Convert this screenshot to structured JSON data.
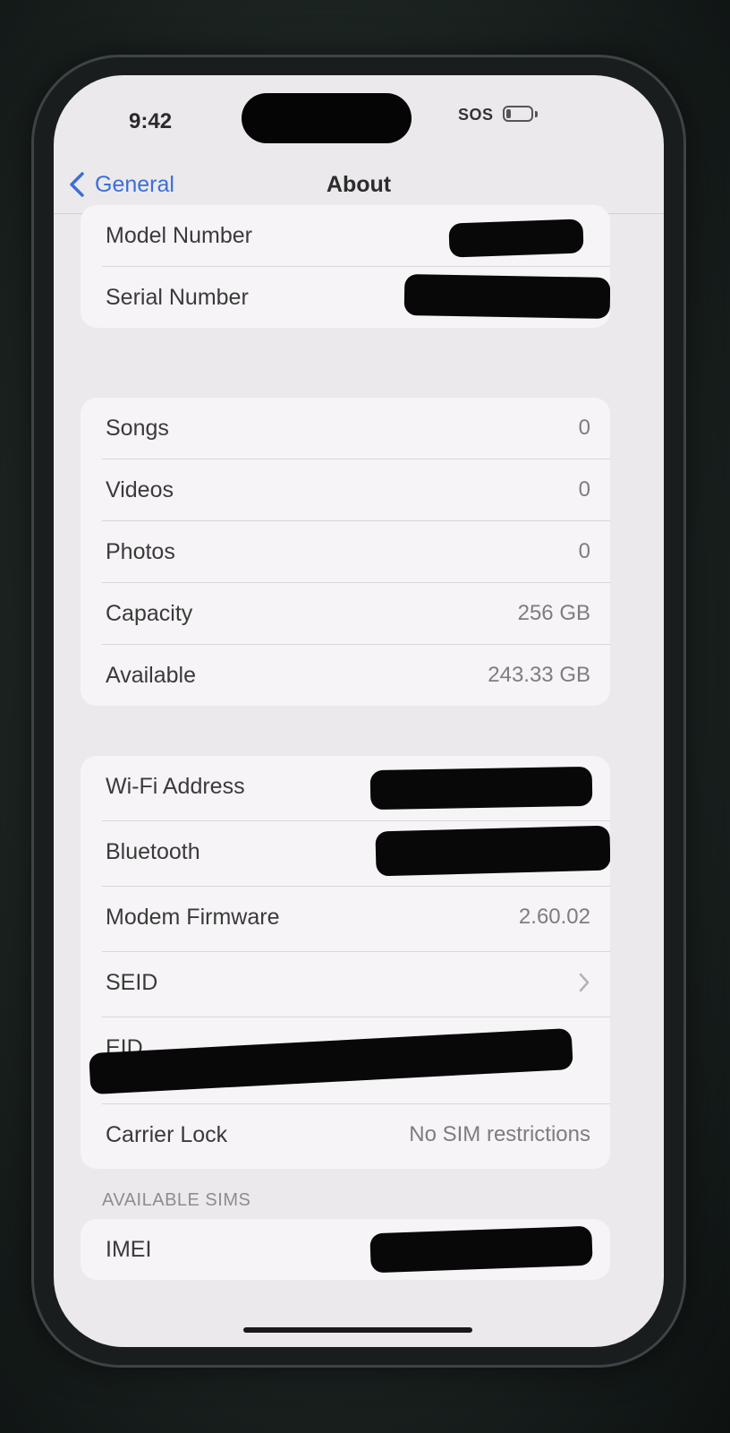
{
  "status_bar": {
    "time": "9:42",
    "carrier_status": "SOS",
    "battery_level": 0.2
  },
  "nav": {
    "back_label": "General",
    "title": "About"
  },
  "group1": {
    "rows": [
      {
        "label": "Model Number",
        "value": ""
      },
      {
        "label": "Serial Number",
        "value": ""
      }
    ]
  },
  "group2": {
    "rows": [
      {
        "label": "Songs",
        "value": "0"
      },
      {
        "label": "Videos",
        "value": "0"
      },
      {
        "label": "Photos",
        "value": "0"
      },
      {
        "label": "Capacity",
        "value": "256 GB"
      },
      {
        "label": "Available",
        "value": "243.33 GB"
      }
    ]
  },
  "group3": {
    "rows": [
      {
        "label": "Wi-Fi Address",
        "value": ""
      },
      {
        "label": "Bluetooth",
        "value": ""
      },
      {
        "label": "Modem Firmware",
        "value": "2.60.02"
      },
      {
        "label": "SEID",
        "value": ""
      },
      {
        "label": "EID",
        "value": ""
      },
      {
        "label": "Carrier Lock",
        "value": "No SIM restrictions"
      }
    ]
  },
  "sims": {
    "header": "AVAILABLE SIMS",
    "rows": [
      {
        "label": "IMEI",
        "value": ""
      }
    ]
  },
  "colors": {
    "accent": "#3b6fd6",
    "background": "#ece9ec",
    "cell": "#f6f4f6"
  }
}
